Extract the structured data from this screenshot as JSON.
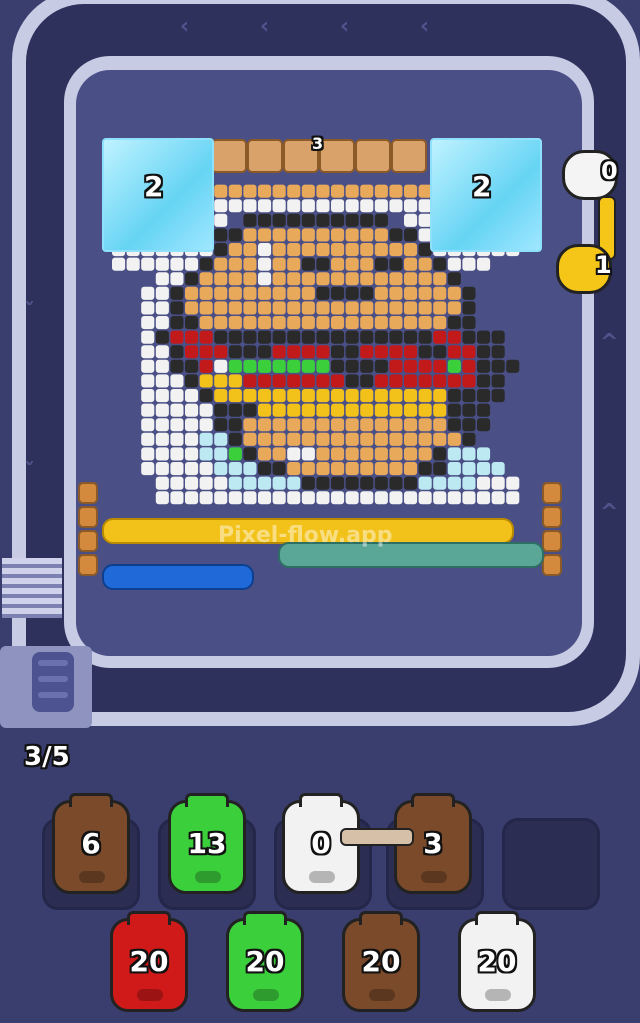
{
  "hud": {
    "queue_count": "3/5",
    "watermark": "Pixel-flow.app"
  },
  "ice_blocks": [
    {
      "id": "left",
      "count": "2"
    },
    {
      "id": "right",
      "count": "2"
    }
  ],
  "top_row_count": "3",
  "hands": [
    {
      "count": "0",
      "color": "#f4f4f4"
    },
    {
      "count": "1",
      "color": "#f5c518"
    }
  ],
  "shooters": [
    {
      "name": "yellow",
      "color": "#f2c21a"
    },
    {
      "name": "teal",
      "color": "#5aa798"
    },
    {
      "name": "blue",
      "color": "#1f6ad8"
    }
  ],
  "active_pigs": [
    {
      "color_name": "brown",
      "color": "#7a4a2a",
      "count": "6"
    },
    {
      "color_name": "green",
      "color": "#3ccf3c",
      "count": "13"
    },
    {
      "color_name": "white",
      "color": "#f2f2f2",
      "count": "0"
    },
    {
      "color_name": "brown",
      "color": "#7a4a2a",
      "count": "3"
    }
  ],
  "reserve_pigs": [
    {
      "color_name": "red",
      "color": "#d01a1a",
      "count": "20"
    },
    {
      "color_name": "green",
      "color": "#3ccf3c",
      "count": "20"
    },
    {
      "color_name": "brown",
      "color": "#7a4a2a",
      "count": "20"
    },
    {
      "color_name": "white",
      "color": "#f2f2f2",
      "count": "20"
    }
  ],
  "palette": {
    "bun": "#e9a95b",
    "outline": "#2a2a2a",
    "white": "#f2f2f2",
    "cheese": "#f2c21a",
    "lettuce": "#3ccf3c",
    "tomato": "#c21a1a",
    "patty": "#6a3a1f",
    "ice": "#bde9f2",
    "skin": "#f0c08a"
  }
}
